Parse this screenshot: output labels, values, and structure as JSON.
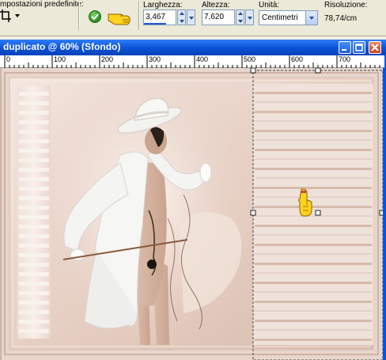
{
  "toolbar": {
    "presets_label": "mpostazioni predefinite:",
    "width_label": "Larghezza:",
    "width_value": "3,467",
    "height_label": "Altezza:",
    "height_value": "7,620",
    "unit_label": "Unità:",
    "unit_value": "Centimetri",
    "resolution_label": "Risoluzione:",
    "resolution_value": "78,74/cm"
  },
  "window": {
    "title": "duplicato @  60% (Sfondo)"
  },
  "ruler": {
    "ticks": [
      "0",
      "100",
      "200",
      "300",
      "400",
      "500",
      "600",
      "700"
    ]
  },
  "colors": {
    "accent": "#0054e3",
    "canvas": "#e6d3c8",
    "strip": "#f3e7e0"
  },
  "icons": [
    "crop-icon",
    "check-icon",
    "hand-pointer-icon",
    "minimize-icon",
    "maximize-icon",
    "close-icon"
  ]
}
